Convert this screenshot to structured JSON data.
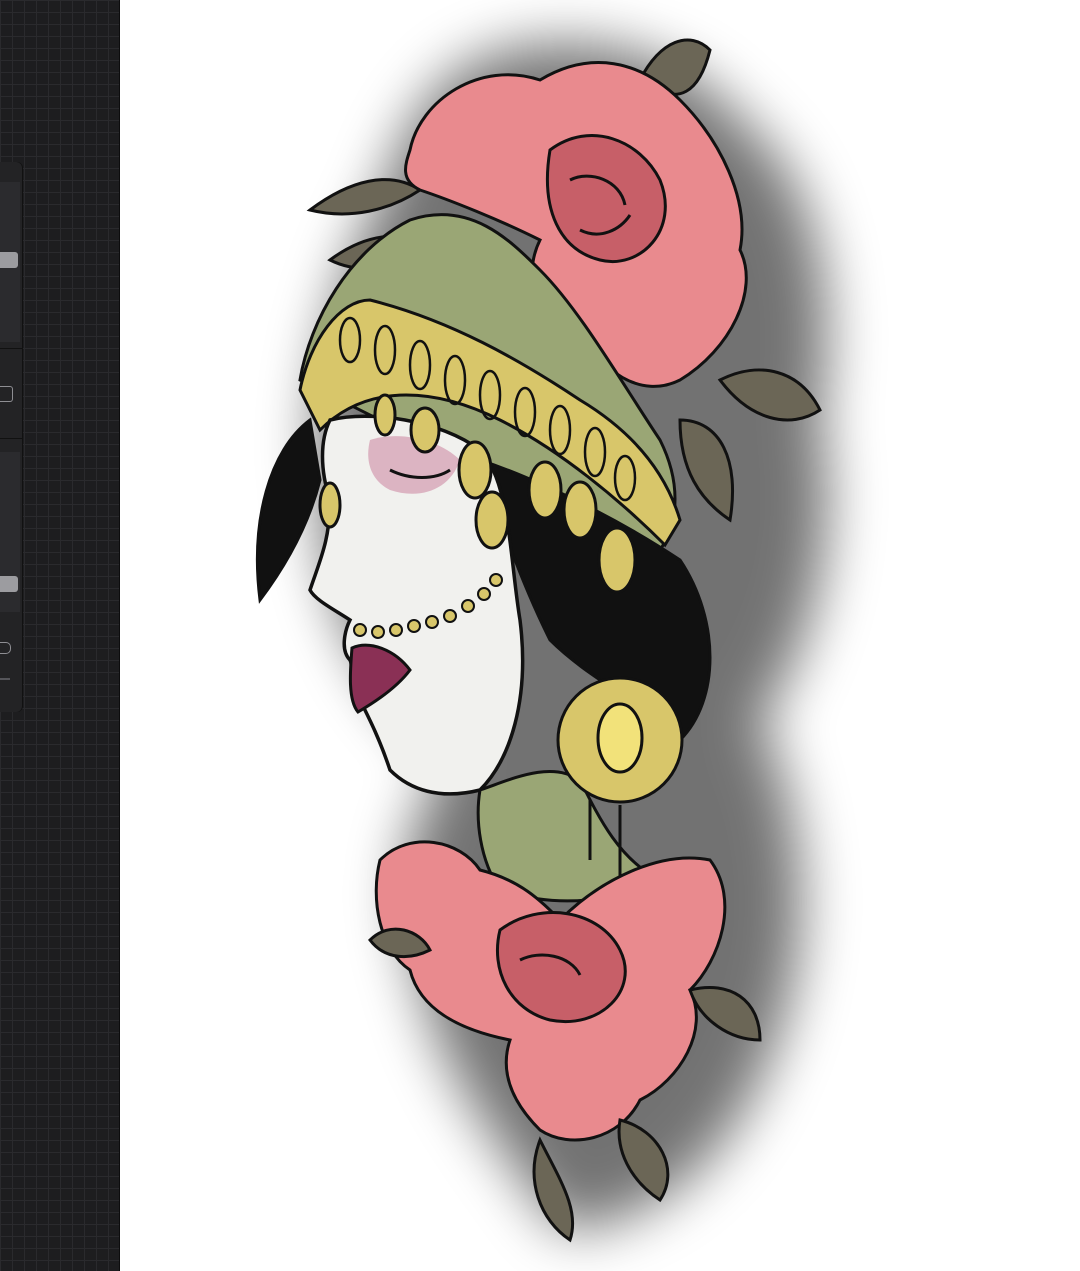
{
  "app": {
    "canvas_bg": "#ffffff",
    "gutter_bg": "#1d1d1f",
    "accent": "#9c9ca0"
  },
  "sidebar": {
    "size_slider": {
      "icon": "brush-size-slider",
      "value": 0.55
    },
    "modify_button": {
      "icon": "square-modify-icon"
    },
    "opacity_slider": {
      "icon": "opacity-slider",
      "value": 0.22
    },
    "undo_button": {
      "icon": "undo-icon"
    },
    "redo_button": {
      "icon": "redo-icon"
    }
  },
  "artwork": {
    "subject": "illustration",
    "colors": {
      "rose": "#e98a8e",
      "rose_dark": "#c75f68",
      "headscarf": "#9aa675",
      "gold": "#d8c66a",
      "hair": "#111111",
      "skin": "#f1f1ee",
      "lips": "#8a3055",
      "leaf": "#6b6656"
    }
  }
}
